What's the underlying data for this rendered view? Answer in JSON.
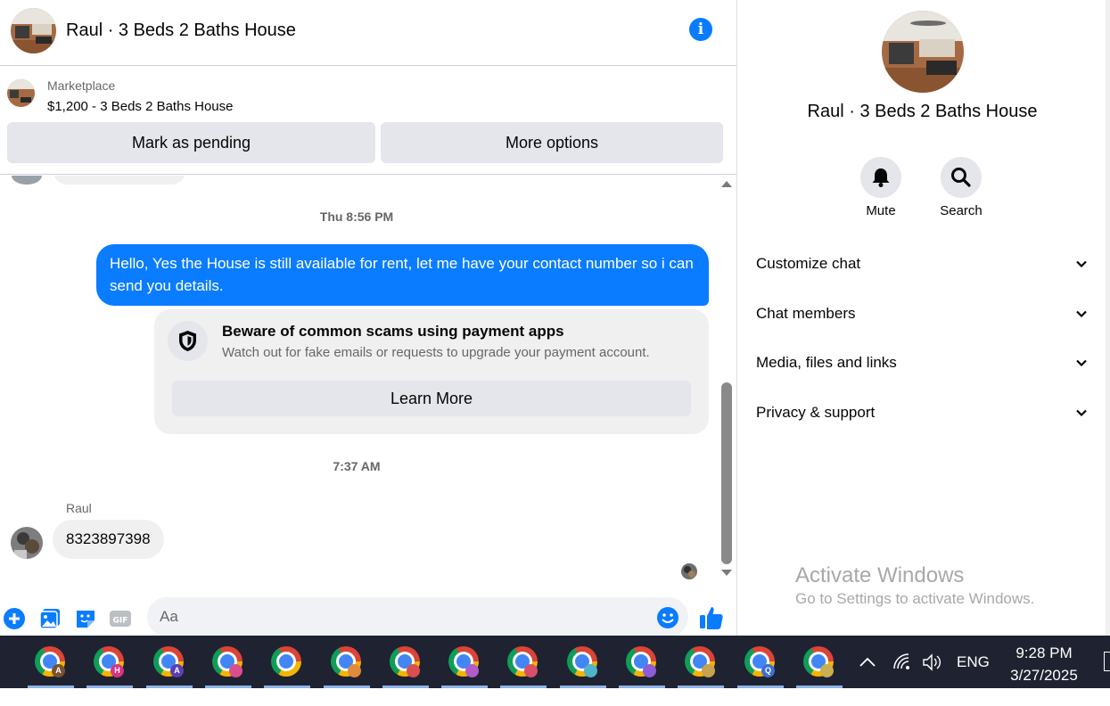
{
  "chat": {
    "title": "Raul · 3 Beds 2 Baths House",
    "marketplace": {
      "label": "Marketplace",
      "listing": "$1,200 - 3 Beds 2 Baths House",
      "pending_button": "Mark as pending",
      "more_button": "More options"
    },
    "messages": {
      "timestamp_1": "Thu 8:56 PM",
      "outgoing_text": "Hello, Yes the House is still available for rent, let me have your contact number so i can send you details.",
      "warning_title": "Beware of common scams using payment apps",
      "warning_body": "Watch out for fake emails or requests to upgrade your payment account.",
      "learn_more": "Learn More",
      "timestamp_2": "7:37 AM",
      "sender": "Raul",
      "incoming_text": "8323897398"
    },
    "composer": {
      "placeholder": "Aa"
    },
    "colors": {
      "accent": "#0a7cff",
      "bubble_gray": "#f0f0f0",
      "button_gray": "#e4e6eb"
    }
  },
  "info_panel": {
    "title": "Raul · 3 Beds 2 Baths House",
    "actions": [
      {
        "label": "Mute",
        "icon": "bell-icon"
      },
      {
        "label": "Search",
        "icon": "search-icon"
      }
    ],
    "sections": [
      {
        "label": "Customize chat"
      },
      {
        "label": "Chat members"
      },
      {
        "label": "Media, files and links"
      },
      {
        "label": "Privacy & support"
      }
    ],
    "watermark": {
      "title": "Activate Windows",
      "subtitle": "Go to Settings to activate Windows."
    }
  },
  "taskbar": {
    "apps": [
      {
        "icon": "chrome-icon",
        "badge": "A",
        "badge_color": "#7a5230"
      },
      {
        "icon": "chrome-icon",
        "badge": "H",
        "badge_color": "#d63384"
      },
      {
        "icon": "chrome-icon",
        "badge": "A",
        "badge_color": "#5b3fb5"
      },
      {
        "icon": "chrome-icon",
        "badge": "",
        "badge_color": "#d94f8c"
      },
      {
        "icon": "chrome-icon",
        "badge": "",
        "badge_color": ""
      },
      {
        "icon": "chrome-icon",
        "badge": "",
        "badge_color": "#e08a3c"
      },
      {
        "icon": "chrome-icon",
        "badge": "",
        "badge_color": "#d94f4f"
      },
      {
        "icon": "chrome-icon",
        "badge": "",
        "badge_color": "#b05cc9"
      },
      {
        "icon": "chrome-icon",
        "badge": "",
        "badge_color": "#d94f6a"
      },
      {
        "icon": "chrome-icon",
        "badge": "",
        "badge_color": "#4fb3c9"
      },
      {
        "icon": "chrome-icon",
        "badge": "",
        "badge_color": "#8c5cd9"
      },
      {
        "icon": "chrome-icon",
        "badge": "",
        "badge_color": "#c9a24f"
      },
      {
        "icon": "chrome-icon",
        "badge": "Q",
        "badge_color": "#3c6fd9"
      },
      {
        "icon": "chrome-icon",
        "badge": "",
        "badge_color": "#c9b04f"
      }
    ],
    "tray": {
      "language": "ENG",
      "time": "9:28 PM",
      "date": "3/27/2025"
    }
  }
}
